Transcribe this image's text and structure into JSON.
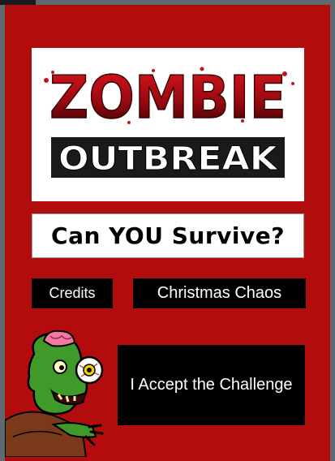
{
  "logo": {
    "line1": "ZOMBIE",
    "line2": "OUTBREAK"
  },
  "tagline": "Can YOU Survive?",
  "buttons": {
    "credits": "Credits",
    "christmas": "Christmas Chaos",
    "accept": "I Accept the Challenge"
  },
  "colors": {
    "background_red": "#b30c0c",
    "logo_red": "#c4141a",
    "button_black": "#000000",
    "zombie_green": "#3f9a2a"
  },
  "icons": {
    "mascot": "zombie-mascot-icon"
  }
}
